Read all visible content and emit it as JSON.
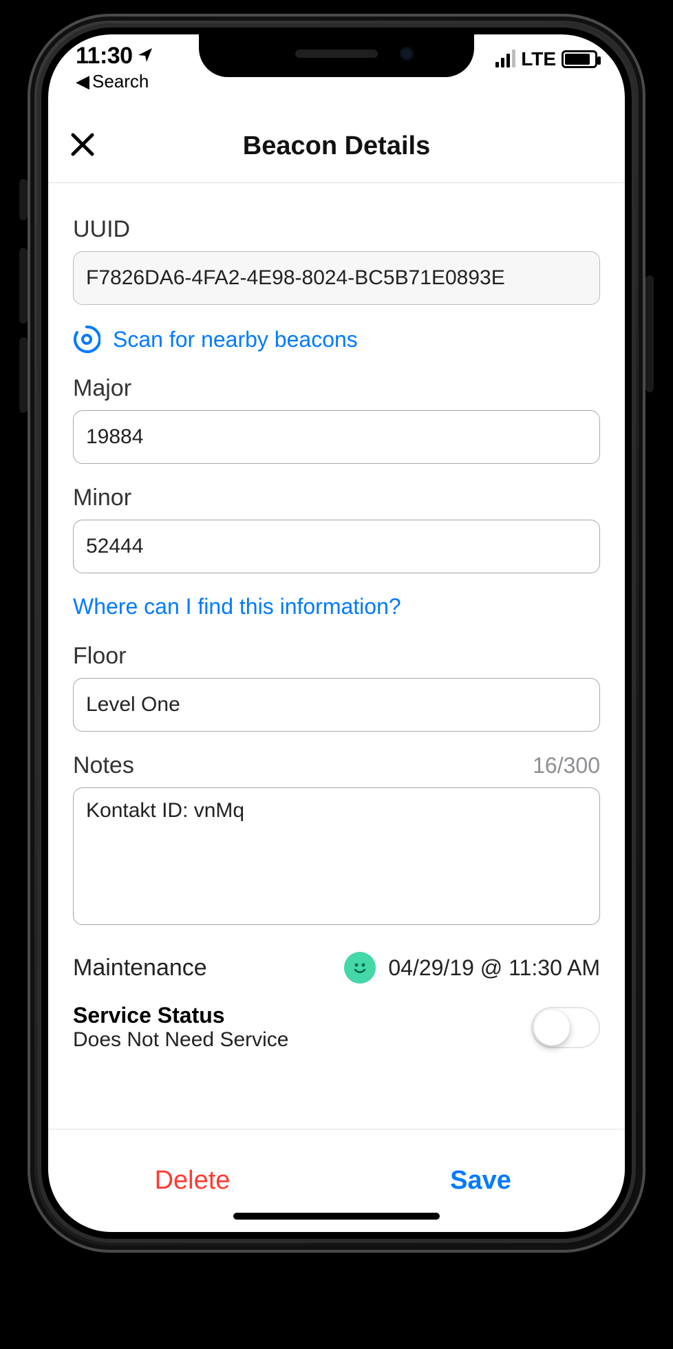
{
  "status": {
    "time": "11:30",
    "location_icon": "location-arrow",
    "back_label": "Search",
    "network": "LTE"
  },
  "navbar": {
    "title": "Beacon Details"
  },
  "form": {
    "uuid": {
      "label": "UUID",
      "value": "F7826DA6-4FA2-4E98-8024-BC5B71E0893E"
    },
    "scan_link": "Scan for nearby beacons",
    "major": {
      "label": "Major",
      "value": "19884"
    },
    "minor": {
      "label": "Minor",
      "value": "52444"
    },
    "info_link": "Where can I find this information?",
    "floor": {
      "label": "Floor",
      "value": "Level One"
    },
    "notes": {
      "label": "Notes",
      "counter": "16/300",
      "value": "Kontakt ID: vnMq"
    }
  },
  "maintenance": {
    "label": "Maintenance",
    "status_icon": "smile",
    "timestamp": "04/29/19 @ 11:30 AM",
    "service_label": "Service Status",
    "service_value": "Does Not Need Service",
    "toggle_on": false
  },
  "footer": {
    "delete": "Delete",
    "save": "Save"
  },
  "colors": {
    "ios_blue": "#007aff",
    "ios_red": "#ff3b30",
    "mint": "#44d7a8"
  }
}
